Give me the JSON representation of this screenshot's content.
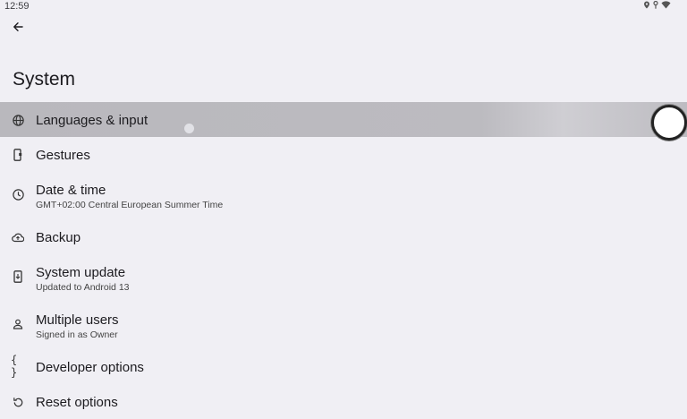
{
  "status_bar": {
    "time": "12:59",
    "icons": [
      "location-icon",
      "vpn-key-icon",
      "wifi-icon"
    ]
  },
  "header": {
    "back_icon": "back-arrow-icon",
    "title": "System"
  },
  "items": [
    {
      "id": "languages",
      "icon": "globe-icon",
      "title": "Languages & input",
      "subtitle": "",
      "selected": true
    },
    {
      "id": "gestures",
      "icon": "phone-gesture-icon",
      "title": "Gestures",
      "subtitle": ""
    },
    {
      "id": "datetime",
      "icon": "clock-icon",
      "title": "Date & time",
      "subtitle": "GMT+02:00 Central European Summer Time"
    },
    {
      "id": "backup",
      "icon": "cloud-backup-icon",
      "title": "Backup",
      "subtitle": ""
    },
    {
      "id": "system-update",
      "icon": "system-update-icon",
      "title": "System update",
      "subtitle": "Updated to Android 13"
    },
    {
      "id": "users",
      "icon": "person-icon",
      "title": "Multiple users",
      "subtitle": "Signed in as Owner"
    },
    {
      "id": "developer",
      "icon": "braces-icon",
      "title": "Developer options",
      "subtitle": ""
    },
    {
      "id": "reset",
      "icon": "reset-icon",
      "title": "Reset options",
      "subtitle": ""
    }
  ],
  "colors": {
    "background": "#f0eff4",
    "selected_row": "#bcbbc0",
    "text_primary": "#1c1b1f",
    "text_secondary": "#444444"
  }
}
